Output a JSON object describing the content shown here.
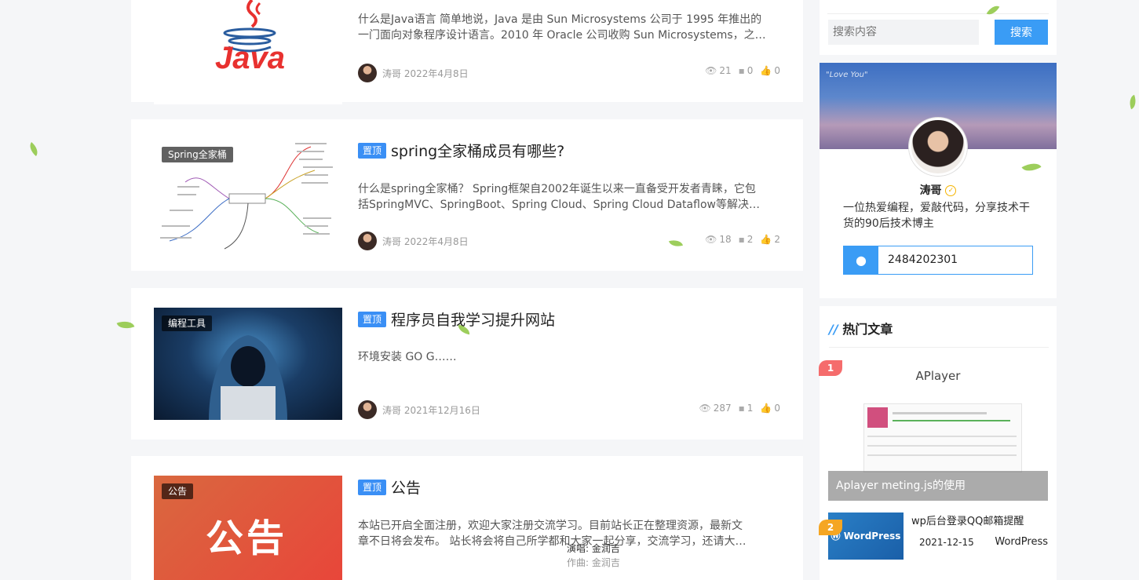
{
  "posts": [
    {
      "pinned": "",
      "category": "",
      "title": "",
      "excerpt": "什么是Java语言 简单地说，Java 是由 Sun Microsystems 公司于 1995 年推出的\n一门面向对象程序设计语言。2010 年 Oracle 公司收购 Sun Microsystems，之…",
      "author": "涛哥",
      "date": "2022年4月8日",
      "views": "21",
      "comments": "0",
      "likes": "0",
      "thumb_text": "Java"
    },
    {
      "pinned": "置顶",
      "category": "Spring全家桶",
      "title": "spring全家桶成员有哪些?",
      "excerpt": "什么是spring全家桶？ Spring框架自2002年诞生以来一直备受开发者青睐，它包\n括SpringMVC、SpringBoot、Spring Cloud、Spring Cloud Dataflow等解决…",
      "author": "涛哥",
      "date": "2022年4月8日",
      "views": "18",
      "comments": "2",
      "likes": "2"
    },
    {
      "pinned": "置顶",
      "category": "编程工具",
      "title": "程序员自我学习提升网站",
      "excerpt": "环境安装 GO G……",
      "author": "涛哥",
      "date": "2021年12月16日",
      "views": "287",
      "comments": "1",
      "likes": "0"
    },
    {
      "pinned": "置顶",
      "category": "公告",
      "title": "公告",
      "excerpt": "本站已开启全面注册，欢迎大家注册交流学习。目前站长正在整理资源，最新文\n章不日将会发布。 站长将会将自己所学都和大家一起分享，交流学习，还请大…",
      "thumb_text": "公告"
    }
  ],
  "sidebar": {
    "search_placeholder": "搜索内容",
    "search_button": "搜索",
    "profile": {
      "banner_text": "\"Love You\"",
      "name": "涛哥",
      "bio": "一位热爱编程，爱敲代码，分享技术干\n货的90后技术博主",
      "qq": "2484202301"
    },
    "hot": {
      "prefix": "//",
      "title": "热门文章",
      "items": [
        {
          "rank": "1",
          "title": "Aplayer meting.js的使用",
          "thumb_heading": "APlayer"
        },
        {
          "rank": "2",
          "title": "wp后台登录QQ邮箱提醒",
          "date": "2021-12-15",
          "tag": "WordPress",
          "thumb_text": "WordPress"
        }
      ]
    }
  },
  "player": {
    "singer": "演唱: 金润吉",
    "composer": "作曲: 金润吉"
  },
  "colors": {
    "accent": "#3a8ff5",
    "rank1": "#f56c6c",
    "rank2": "#f5a623"
  }
}
